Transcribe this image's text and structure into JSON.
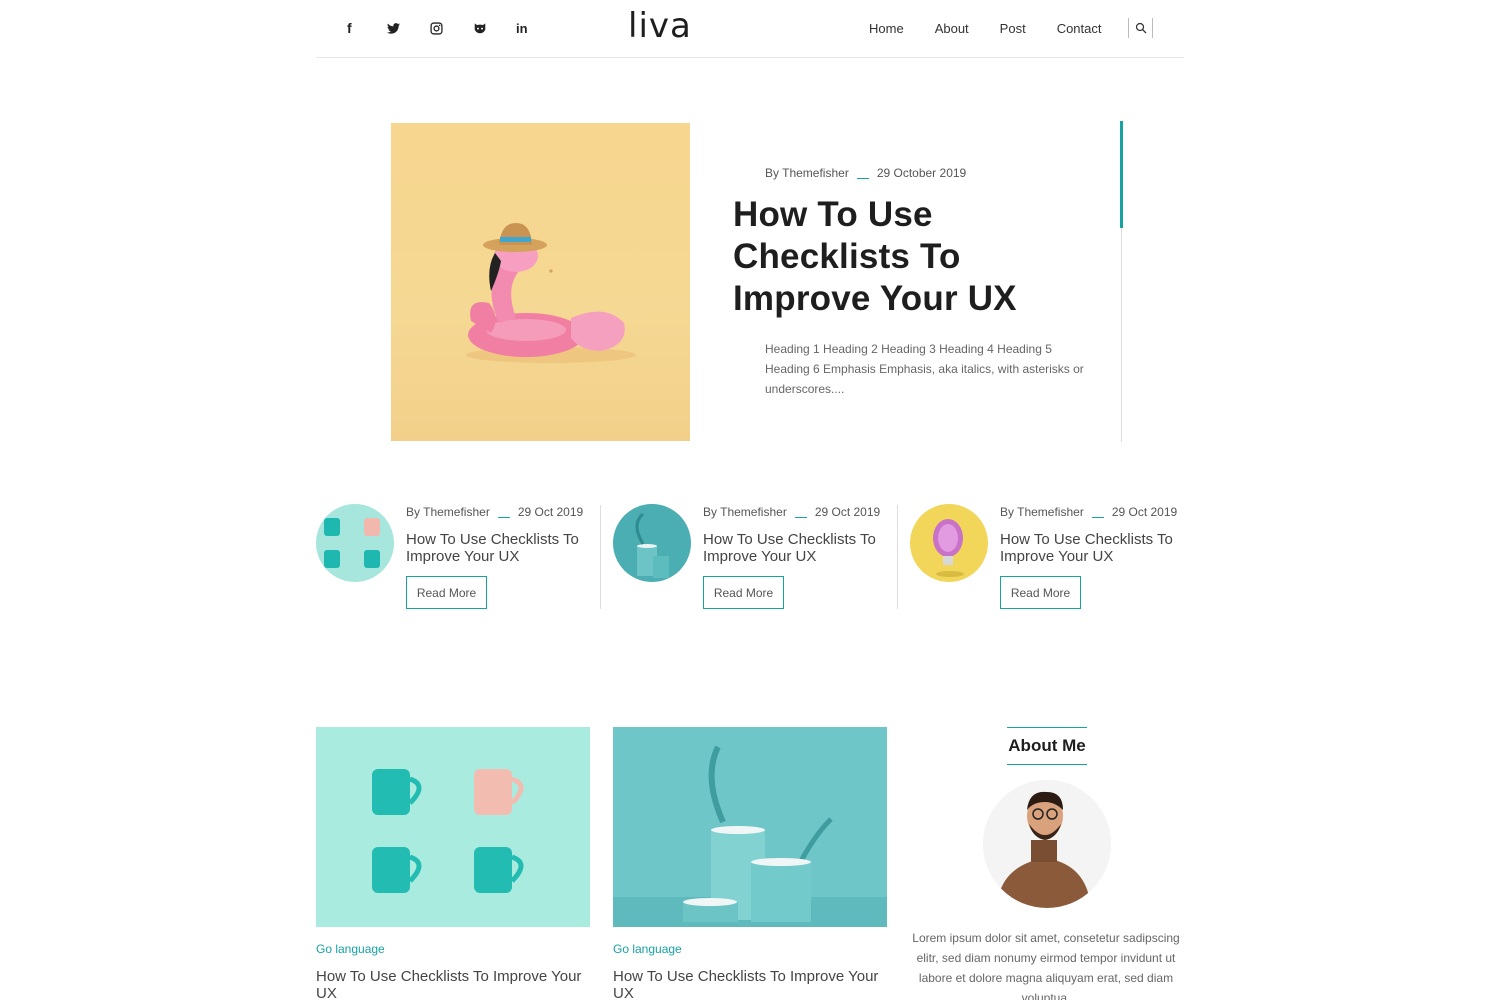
{
  "header": {
    "logo": "liva",
    "socials": [
      {
        "icon": "facebook-icon",
        "glyph": "f"
      },
      {
        "icon": "twitter-icon"
      },
      {
        "icon": "instagram-icon"
      },
      {
        "icon": "github-icon"
      },
      {
        "icon": "linkedin-icon",
        "glyph": "in"
      }
    ],
    "nav": [
      "Home",
      "About",
      "Post",
      "Contact"
    ],
    "search_icon": "search-icon"
  },
  "hero": {
    "author": "By Themefisher",
    "date": "29 October 2019",
    "title": "How To Use Checklists To Improve Your UX",
    "excerpt": "Heading 1 Heading 2 Heading 3 Heading 4 Heading 5 Heading 6 Emphasis Emphasis, aka italics, with asterisks or underscores...."
  },
  "small_posts": [
    {
      "author": "By Themefisher",
      "date": "29 Oct 2019",
      "title": "How To Use Checklists To Improve Your UX",
      "button": "Read More"
    },
    {
      "author": "By Themefisher",
      "date": "29 Oct 2019",
      "title": "How To Use Checklists To Improve Your UX",
      "button": "Read More"
    },
    {
      "author": "By Themefisher",
      "date": "29 Oct 2019",
      "title": "How To Use Checklists To Improve Your UX",
      "button": "Read More"
    }
  ],
  "cards": [
    {
      "category": "Go language",
      "title": "How To Use Checklists To Improve Your UX"
    },
    {
      "category": "Go language",
      "title": "How To Use Checklists To Improve Your UX"
    }
  ],
  "about": {
    "title": "About Me",
    "text": "Lorem ipsum dolor sit amet, consetetur sadipscing elitr, sed diam nonumy eirmod tempor invidunt ut labore et dolore magna aliquyam erat, sed diam voluptua."
  },
  "colors": {
    "accent": "#17a2a4",
    "text": "#1e1e1e",
    "hero_bg": "#f6d690"
  }
}
